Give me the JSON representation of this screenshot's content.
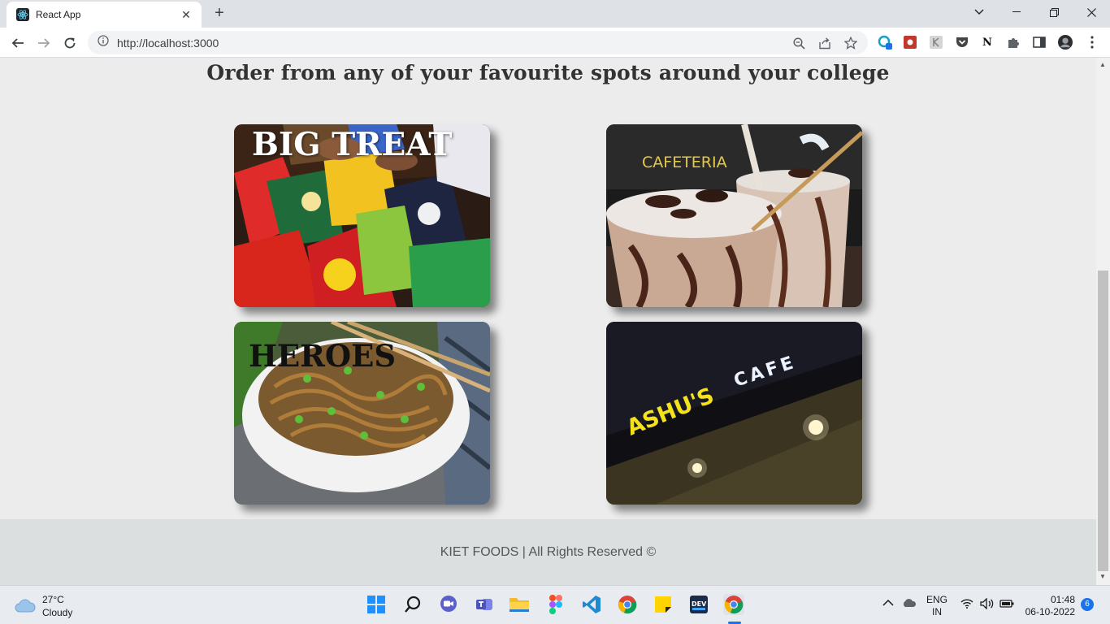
{
  "browser": {
    "tab_title": "React App",
    "url": "http://localhost:3000",
    "new_tab": "+",
    "close_tab": "✕"
  },
  "page": {
    "heading": "Order from any of your favourite spots around your college",
    "cards": [
      {
        "label": "BIG TREAT",
        "image": "chips-snacks-photo"
      },
      {
        "label": "CAFETERIA",
        "image": "milkshake-photo"
      },
      {
        "label": "HEROES",
        "image": "noodles-bowl-photo"
      },
      {
        "label": "",
        "image": "cafe-storefront-photo"
      }
    ],
    "storefront_sign": "ASHU'S",
    "storefront_sign2": "CAFE",
    "footer": "KIET FOODS | All Rights Reserved ©"
  },
  "taskbar": {
    "weather_temp": "27°C",
    "weather_desc": "Cloudy",
    "lang_top": "ENG",
    "lang_bottom": "IN",
    "time": "01:48",
    "date": "06-10-2022",
    "notifications": "6"
  },
  "extensions": {
    "notion_label": "N"
  },
  "colors": {
    "accent_blue": "#1a73e8",
    "page_bg": "#ececec",
    "footer_bg": "#dcdfe0",
    "cafeteria_label": "#e6c84a"
  }
}
